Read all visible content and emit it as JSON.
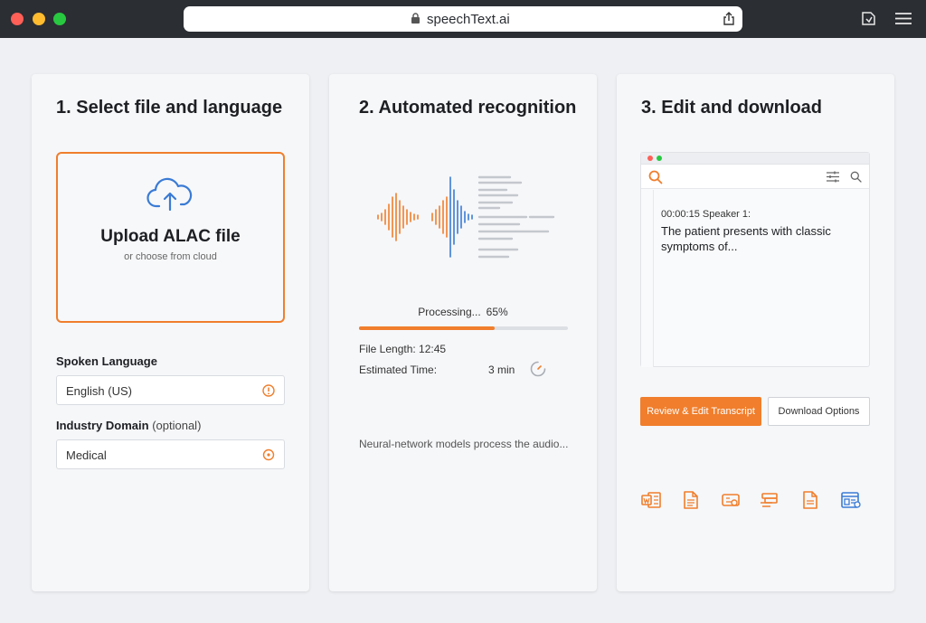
{
  "browser": {
    "url": "speechText.ai",
    "icons": [
      "close-dot",
      "minimize-dot",
      "zoom-dot",
      "lock-icon",
      "share-icon",
      "sidebar-tab-icon",
      "menu-icon"
    ]
  },
  "step1": {
    "title": "1. Select file and language",
    "upload": {
      "title": "Upload ALAC file",
      "subtitle": "or choose from cloud",
      "icon": "cloud-upload-icon"
    },
    "language": {
      "label": "Spoken Language",
      "value": "English (US)"
    },
    "domain": {
      "label": "Industry Domain",
      "label_optional": "(optional)",
      "value": "Medical"
    }
  },
  "step2": {
    "title": "2. Automated recognition",
    "processing_label": "Processing...",
    "progress_text": "65%",
    "progress": 0.65,
    "file_length": "File Length: 12:45",
    "estimated_label": "Estimated Time:",
    "estimated_value": "3 min",
    "description": "Neural-network models process the audio..."
  },
  "step3": {
    "title": "3. Edit and download",
    "transcript": {
      "timestamp": "00:00:15 Speaker 1:",
      "text": "The patient presents with classic symptoms of..."
    },
    "review_button": "Review & Edit Transcript",
    "download_button": "Download Options",
    "formats": [
      "word-doc-icon",
      "txt-doc-icon",
      "subtitle-icon",
      "table-format-icon",
      "pdf-doc-icon",
      "json-format-icon"
    ]
  },
  "colors": {
    "accent": "#f07e2c",
    "blue": "#3a7bd5",
    "chrome": "#2b2e33"
  }
}
